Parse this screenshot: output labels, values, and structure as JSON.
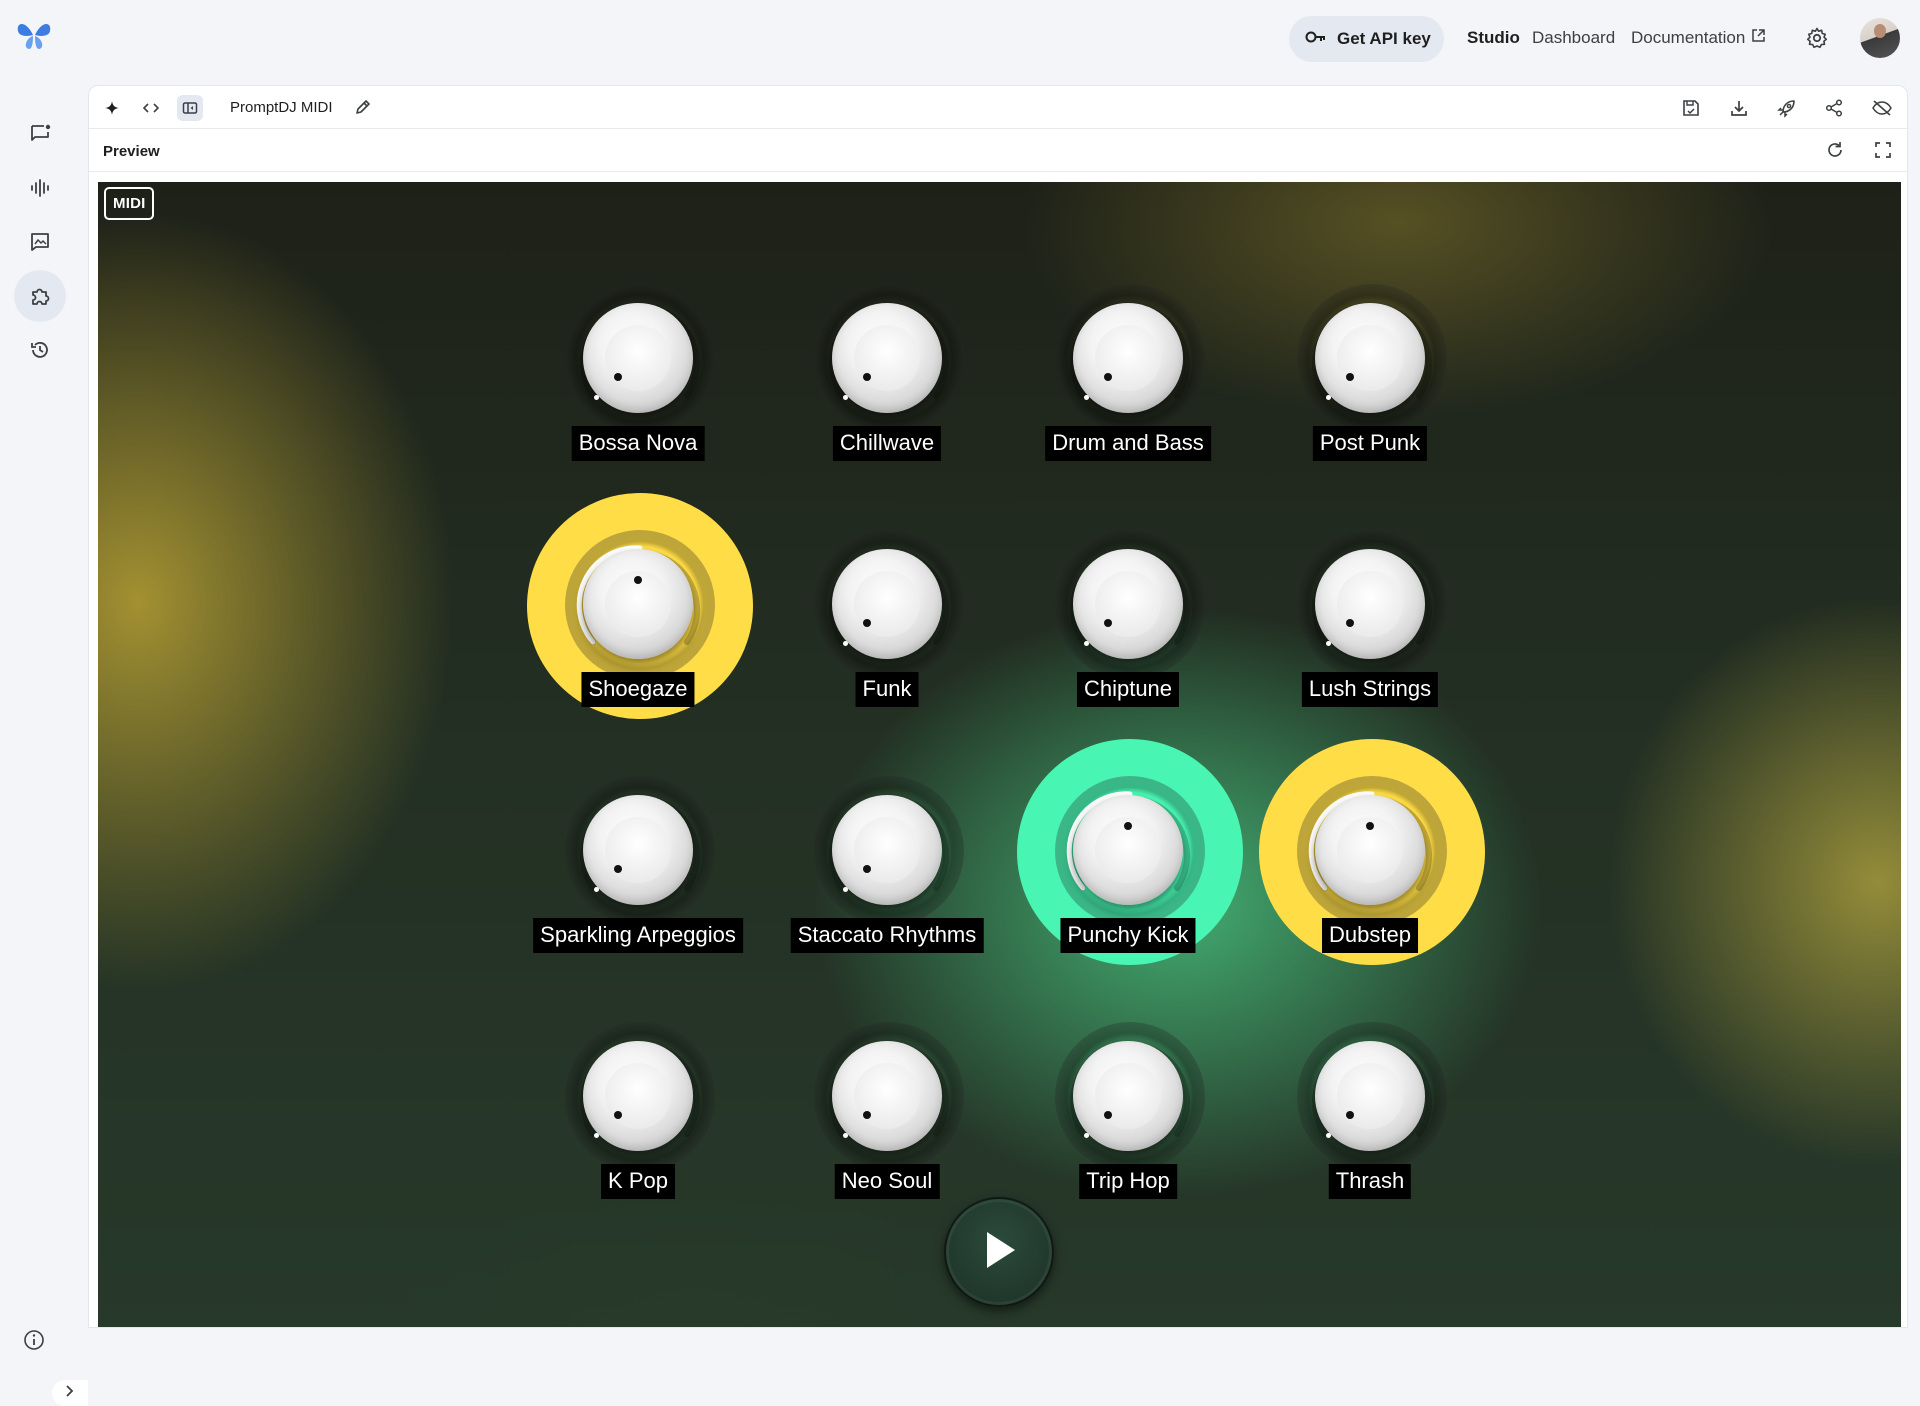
{
  "header": {
    "api_key_label": "Get API key",
    "nav": {
      "studio": "Studio",
      "dashboard": "Dashboard",
      "documentation": "Documentation"
    },
    "icons": [
      "logo-icon",
      "key-icon",
      "external-link-icon",
      "gear-icon",
      "avatar"
    ]
  },
  "toolbar": {
    "app_title": "PromptDJ MIDI",
    "preview_label": "Preview"
  },
  "stage": {
    "midi_label": "MIDI",
    "colors": {
      "yellow": "#ffdd47",
      "green": "#49f5b2"
    },
    "knobs": [
      {
        "label": "Bossa Nova",
        "active": false
      },
      {
        "label": "Chillwave",
        "active": false
      },
      {
        "label": "Drum and Bass",
        "active": false
      },
      {
        "label": "Post Punk",
        "active": false
      },
      {
        "label": "Shoegaze",
        "active": true,
        "color": "#ffdd47",
        "level": 0.5
      },
      {
        "label": "Funk",
        "active": false
      },
      {
        "label": "Chiptune",
        "active": false
      },
      {
        "label": "Lush Strings",
        "active": false
      },
      {
        "label": "Sparkling Arpeggios",
        "active": false
      },
      {
        "label": "Staccato Rhythms",
        "active": false
      },
      {
        "label": "Punchy Kick",
        "active": true,
        "color": "#49f5b2",
        "level": 0.5
      },
      {
        "label": "Dubstep",
        "active": true,
        "color": "#ffdd47",
        "level": 0.5
      },
      {
        "label": "K Pop",
        "active": false
      },
      {
        "label": "Neo Soul",
        "active": false
      },
      {
        "label": "Trip Hop",
        "active": false
      },
      {
        "label": "Thrash",
        "active": false
      }
    ]
  }
}
